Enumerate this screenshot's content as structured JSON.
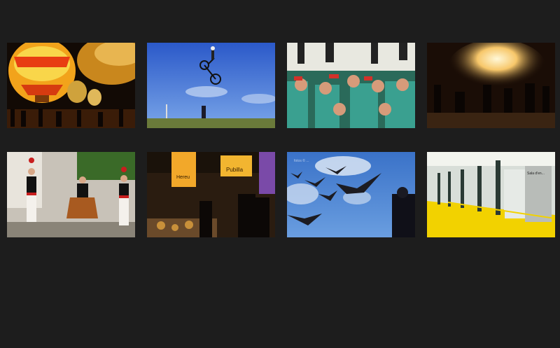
{
  "gallery": {
    "thumbnails": [
      {
        "subject": "hot-air-balloons-night"
      },
      {
        "subject": "bmx-jump-blue-sky"
      },
      {
        "subject": "human-tower-crowd"
      },
      {
        "subject": "fire-runners-correfoc"
      },
      {
        "subject": "folk-dancers-street"
      },
      {
        "subject": "market-stalls-signs",
        "signs": [
          "Hereu",
          "Pubilla"
        ]
      },
      {
        "subject": "seagulls-flying",
        "watermark": "fotos © ..."
      },
      {
        "subject": "museum-corridor-yellow-floor",
        "panel_text": "Sala d'en..."
      }
    ]
  }
}
